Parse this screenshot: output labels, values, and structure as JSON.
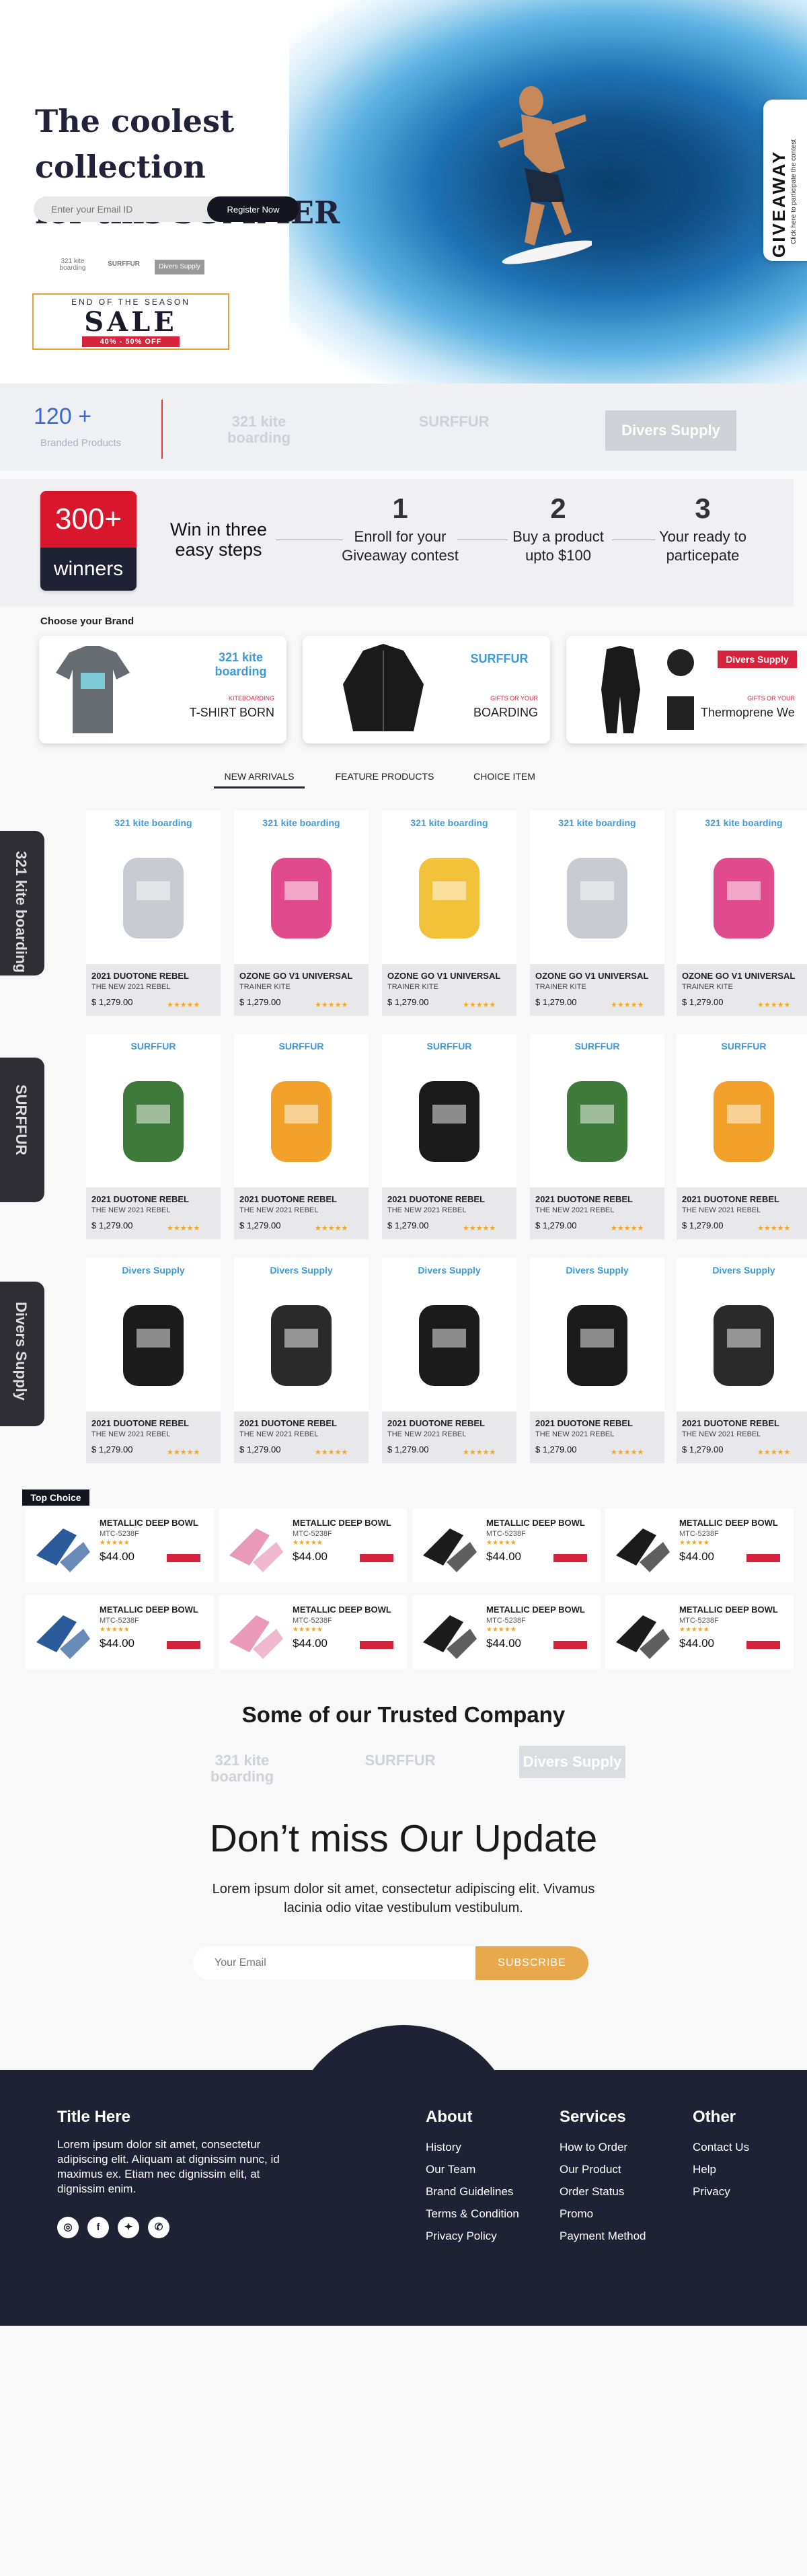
{
  "hero": {
    "title_line1": "The coolest collection",
    "title_line2": "for this SUMMER",
    "email_placeholder": "Enter your Email ID",
    "register_label": "Register Now",
    "sale_top": "END OF THE SEASON",
    "sale_main": "SALE",
    "sale_off": "40% - 50% OFF",
    "giveaway": "GIVEAWAY",
    "giveaway_sub": "Click here to participate the contest"
  },
  "stats": {
    "count": "120 +",
    "label": "Branded Products"
  },
  "brands": {
    "b1": "321 kite boarding",
    "b2": "SURFFUR",
    "b3": "Divers Supply"
  },
  "steps": {
    "badge_number": "300+",
    "badge_word": "winners",
    "heading": "Win in three easy steps",
    "items": [
      {
        "n": "1",
        "text": "Enroll for your Giveaway contest"
      },
      {
        "n": "2",
        "text": "Buy a product upto $100"
      },
      {
        "n": "3",
        "text": "Your ready to particepate"
      }
    ]
  },
  "choose": {
    "label": "Choose your Brand",
    "cards": [
      {
        "logo": "321 kite boarding",
        "sub": "KITEBOARDING",
        "name": "T-SHIRT BORN"
      },
      {
        "logo": "SURFFUR",
        "sub": "GIFTS OR YOUR",
        "name": "BOARDING"
      },
      {
        "logo": "Divers Supply",
        "sub": "GIFTS OR YOUR",
        "name": "Thermoprene We"
      }
    ]
  },
  "tabs": [
    "NEW ARRIVALS",
    "FEATURE PRODUCTS",
    "CHOICE ITEM"
  ],
  "side_tabs": [
    "321 kite boarding",
    "SURFFUR",
    "Divers Supply"
  ],
  "rows": [
    {
      "logo": "321 kite boarding",
      "items": [
        {
          "name": "2021 DUOTONE REBEL",
          "sub": "THE NEW 2021 REBEL",
          "price": "$ 1,279.00",
          "stars": "★★★★★"
        },
        {
          "name": "OZONE GO V1 UNIVERSAL",
          "sub": "TRAINER KITE",
          "price": "$ 1,279.00",
          "stars": "★★★★★"
        },
        {
          "name": "OZONE GO V1 UNIVERSAL",
          "sub": "TRAINER KITE",
          "price": "$ 1,279.00",
          "stars": "★★★★★"
        },
        {
          "name": "OZONE GO V1 UNIVERSAL",
          "sub": "TRAINER KITE",
          "price": "$ 1,279.00",
          "stars": "★★★★★"
        },
        {
          "name": "OZONE GO V1 UNIVERSAL",
          "sub": "TRAINER KITE",
          "price": "$ 1,279.00",
          "stars": "★★★★★"
        }
      ]
    },
    {
      "logo": "SURFFUR",
      "items": [
        {
          "name": "2021 DUOTONE REBEL",
          "sub": "THE NEW 2021 REBEL",
          "price": "$ 1,279.00",
          "stars": "★★★★★"
        },
        {
          "name": "2021 DUOTONE REBEL",
          "sub": "THE NEW 2021 REBEL",
          "price": "$ 1,279.00",
          "stars": "★★★★★"
        },
        {
          "name": "2021 DUOTONE REBEL",
          "sub": "THE NEW 2021 REBEL",
          "price": "$ 1,279.00",
          "stars": "★★★★★"
        },
        {
          "name": "2021 DUOTONE REBEL",
          "sub": "THE NEW 2021 REBEL",
          "price": "$ 1,279.00",
          "stars": "★★★★★"
        },
        {
          "name": "2021 DUOTONE REBEL",
          "sub": "THE NEW 2021 REBEL",
          "price": "$ 1,279.00",
          "stars": "★★★★★"
        }
      ]
    },
    {
      "logo": "Divers Supply",
      "items": [
        {
          "name": "2021 DUOTONE REBEL",
          "sub": "THE NEW 2021 REBEL",
          "price": "$ 1,279.00",
          "stars": "★★★★★"
        },
        {
          "name": "2021 DUOTONE REBEL",
          "sub": "THE NEW 2021 REBEL",
          "price": "$ 1,279.00",
          "stars": "★★★★★"
        },
        {
          "name": "2021 DUOTONE REBEL",
          "sub": "THE NEW 2021 REBEL",
          "price": "$ 1,279.00",
          "stars": "★★★★★"
        },
        {
          "name": "2021 DUOTONE REBEL",
          "sub": "THE NEW 2021 REBEL",
          "price": "$ 1,279.00",
          "stars": "★★★★★"
        },
        {
          "name": "2021 DUOTONE REBEL",
          "sub": "THE NEW 2021 REBEL",
          "price": "$ 1,279.00",
          "stars": "★★★★★"
        }
      ]
    }
  ],
  "top_choice": {
    "badge": "Top Choice",
    "items": [
      {
        "title": "METALLIC DEEP BOWL",
        "code": "MTC-5238F",
        "stars": "★★★★★",
        "price": "$44.00"
      },
      {
        "title": "METALLIC DEEP BOWL",
        "code": "MTC-5238F",
        "stars": "★★★★★",
        "price": "$44.00"
      },
      {
        "title": "METALLIC DEEP BOWL",
        "code": "MTC-5238F",
        "stars": "★★★★★",
        "price": "$44.00"
      },
      {
        "title": "METALLIC DEEP BOWL",
        "code": "MTC-5238F",
        "stars": "★★★★★",
        "price": "$44.00"
      },
      {
        "title": "METALLIC DEEP BOWL",
        "code": "MTC-5238F",
        "stars": "★★★★★",
        "price": "$44.00"
      },
      {
        "title": "METALLIC DEEP BOWL",
        "code": "MTC-5238F",
        "stars": "★★★★★",
        "price": "$44.00"
      },
      {
        "title": "METALLIC DEEP BOWL",
        "code": "MTC-5238F",
        "stars": "★★★★★",
        "price": "$44.00"
      },
      {
        "title": "METALLIC DEEP BOWL",
        "code": "MTC-5238F",
        "stars": "★★★★★",
        "price": "$44.00"
      }
    ]
  },
  "trusted": {
    "title": "Some of our Trusted Company"
  },
  "newsletter": {
    "title": "Don’t miss Our Update",
    "text": "Lorem ipsum dolor sit amet, consectetur adipiscing elit. Vivamus lacinia odio vitae vestibulum vestibulum.",
    "placeholder": "Your Email",
    "button": "SUBSCRIBE"
  },
  "footer": {
    "title": "Title Here",
    "text": "Lorem ipsum dolor sit amet, consectetur adipiscing elit. Aliquam at dignissim nunc, id maximus ex. Etiam nec dignissim elit, at dignissim enim.",
    "cols": [
      {
        "title": "About",
        "links": [
          "History",
          "Our Team",
          "Brand Guidelines",
          "Terms & Condition",
          "Privacy Policy"
        ]
      },
      {
        "title": "Services",
        "links": [
          "How to Order",
          "Our Product",
          "Order Status",
          "Promo",
          "Payment Method"
        ]
      },
      {
        "title": "Other",
        "links": [
          "Contact Us",
          "Help",
          "Privacy"
        ]
      }
    ]
  },
  "colors": {
    "accent": "#e9a84c",
    "dark": "#1f2135",
    "red": "#d6223a"
  }
}
